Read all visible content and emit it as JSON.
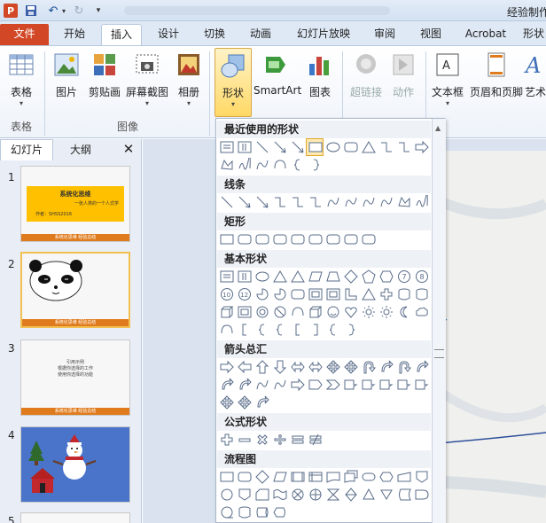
{
  "app": {
    "title_text": "经验制作"
  },
  "quick_access": {
    "logo_letter": "P"
  },
  "tabs": [
    {
      "label": "文件"
    },
    {
      "label": "开始"
    },
    {
      "label": "插入"
    },
    {
      "label": "设计"
    },
    {
      "label": "切换"
    },
    {
      "label": "动画"
    },
    {
      "label": "幻灯片放映"
    },
    {
      "label": "审阅"
    },
    {
      "label": "视图"
    },
    {
      "label": "Acrobat"
    },
    {
      "label": "形状"
    }
  ],
  "ribbon": {
    "buttons": [
      {
        "label": "表格",
        "icon": "table-icon"
      },
      {
        "label": "图片",
        "icon": "picture-icon"
      },
      {
        "label": "剪贴画",
        "icon": "clipart-icon"
      },
      {
        "label": "屏幕截图",
        "icon": "screenshot-icon"
      },
      {
        "label": "相册",
        "icon": "album-icon"
      },
      {
        "label": "形状",
        "icon": "shapes-icon"
      },
      {
        "label": "SmartArt",
        "icon": "smartart-icon"
      },
      {
        "label": "图表",
        "icon": "chart-icon"
      },
      {
        "label": "超链接",
        "icon": "hyperlink-icon"
      },
      {
        "label": "动作",
        "icon": "action-icon"
      },
      {
        "label": "文本框",
        "icon": "textbox-icon"
      },
      {
        "label": "页眉和页脚",
        "icon": "header-footer-icon"
      },
      {
        "label": "艺术",
        "icon": "wordart-icon"
      }
    ],
    "groups": [
      {
        "label": "表格"
      },
      {
        "label": "图像"
      }
    ]
  },
  "left_panel": {
    "tab_slides": "幻灯片",
    "tab_outline": "大纲",
    "close": "✕",
    "slides": [
      {
        "number": "1",
        "title": "系统化思维",
        "subtitle": "一张人类的一个人式学",
        "author": "作者：SHSS2016",
        "footer": "系统化思维 经验总结"
      },
      {
        "number": "2",
        "footer": "系统化思维 经验总结"
      },
      {
        "number": "3",
        "lines": [
          "引用示例",
          "根据你选择的工作",
          "使用你选择的功能"
        ],
        "footer": "系统化思维 经验总结"
      },
      {
        "number": "4"
      },
      {
        "number": "5"
      }
    ]
  },
  "gallery": {
    "sections": [
      {
        "title": "最近使用的形状"
      },
      {
        "title": "线条"
      },
      {
        "title": "矩形"
      },
      {
        "title": "基本形状"
      },
      {
        "title": "箭头总汇"
      },
      {
        "title": "公式形状"
      },
      {
        "title": "流程图"
      }
    ]
  },
  "colors": {
    "file_tab": "#d24726",
    "ribbon_bg": "#eef3fa",
    "selected_button": "#ffd866",
    "slide_footer": "#e07b1d",
    "slide1_banner": "#ffc000",
    "slide4_bg": "#4a74c9"
  }
}
